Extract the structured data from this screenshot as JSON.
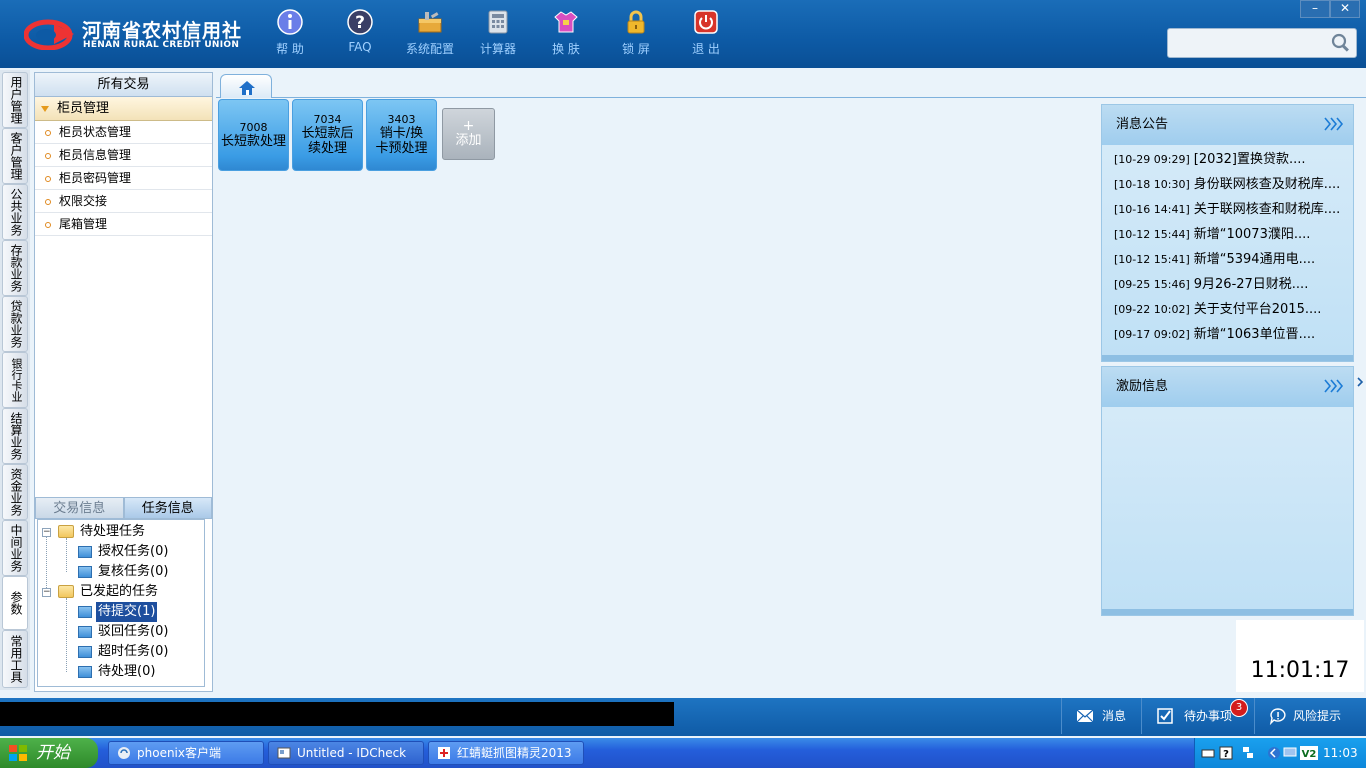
{
  "logo": {
    "cn": "河南省农村信用社",
    "en": "HENAN RURAL CREDIT UNION"
  },
  "toolbar": [
    {
      "label": "帮 助",
      "icon": "info-icon"
    },
    {
      "label": "FAQ",
      "icon": "question-icon"
    },
    {
      "label": "系统配置",
      "icon": "toolbox-icon"
    },
    {
      "label": "计算器",
      "icon": "calculator-icon"
    },
    {
      "label": "换 肤",
      "icon": "shirt-icon"
    },
    {
      "label": "锁 屏",
      "icon": "lock-icon"
    },
    {
      "label": "退 出",
      "icon": "power-icon"
    }
  ],
  "window": {
    "minimize": "–",
    "close": "✕"
  },
  "search": {
    "value": "",
    "placeholder": ""
  },
  "vnav": [
    "用户管理",
    "客户管理",
    "公共业务",
    "存款业务",
    "贷款业务",
    "银行卡业务",
    "结算业务",
    "资金业务",
    "中间业务",
    "参数",
    "常用工具"
  ],
  "left_panel": {
    "title": "所有交易",
    "group": "柜员管理",
    "items": [
      "柜员状态管理",
      "柜员信息管理",
      "柜员密码管理",
      "权限交接",
      "尾箱管理"
    ],
    "tabs": [
      "交易信息",
      "任务信息"
    ],
    "tree": {
      "pending": "待处理任务",
      "pending_children": [
        "授权任务(0)",
        "复核任务(0)"
      ],
      "started": "已发起的任务",
      "started_children": [
        "待提交(1)",
        "驳回任务(0)",
        "超时任务(0)",
        "待处理(0)"
      ]
    }
  },
  "tiles": [
    {
      "code": "7008",
      "name": "长短款处理"
    },
    {
      "code": "7034",
      "name": "长短款后\n续处理"
    },
    {
      "code": "3403",
      "name": "销卡/换\n卡预处理"
    }
  ],
  "add_tile": {
    "plus": "+",
    "label": "添加"
  },
  "notices": {
    "title": "消息公告",
    "items": [
      {
        "time": "[10-29 09:29]",
        "text": "[2032]置换贷款...."
      },
      {
        "time": "[10-18 10:30]",
        "text": "身份联网核查及财税库...."
      },
      {
        "time": "[10-16 14:41]",
        "text": "关于联网核查和财税库...."
      },
      {
        "time": "[10-12 15:44]",
        "text": "新增“10073濮阳...."
      },
      {
        "time": "[10-12 15:41]",
        "text": "新增“5394通用电...."
      },
      {
        "time": "[09-25 15:46]",
        "text": "9月26-27日财税...."
      },
      {
        "time": "[09-22 10:02]",
        "text": "关于支付平台2015...."
      },
      {
        "time": "[09-17 09:02]",
        "text": "新增“1063单位晋...."
      }
    ]
  },
  "incentive": {
    "title": "激励信息"
  },
  "clock": "11:01:17",
  "statusbar": {
    "messages": "消息",
    "todo": "待办事项",
    "todo_count": "3",
    "risk": "风险提示"
  },
  "taskbar": {
    "start": "开始",
    "tasks": [
      "phoenix客户端",
      "Untitled - IDCheck",
      "红蜻蜓抓图精灵2013"
    ],
    "time": "11:03"
  }
}
